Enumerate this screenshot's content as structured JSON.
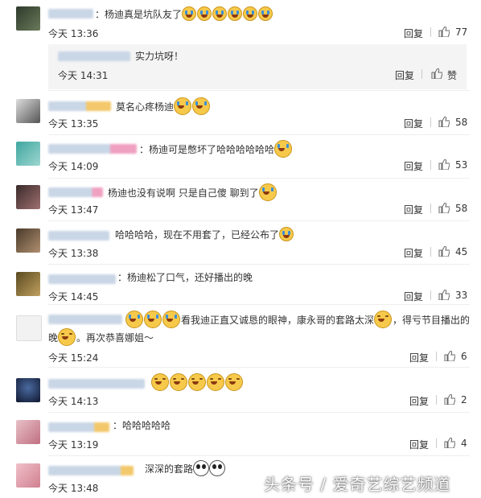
{
  "comments": [
    {
      "text": "：杨迪真是坑队友了",
      "time": "今天 13:36",
      "reply": "回复",
      "likes": "77",
      "emoji_count": 6
    },
    {
      "text": "：杨迪可是憋坏了哈哈哈哈哈哈",
      "time": "今天 14:09",
      "reply": "回复",
      "likes": "53",
      "emoji_count": 1
    },
    {
      "text": "莫名心疼杨迪",
      "time": "今天 13:35",
      "reply": "回复",
      "likes": "58",
      "emoji_count": 2
    },
    {
      "text": "杨迪也没有说啊 只是自己傻 聊到了",
      "time": "今天 13:47",
      "reply": "回复",
      "likes": "58",
      "emoji_count": 1
    },
    {
      "text": "哈哈哈哈，现在不用套了，已经公布了",
      "time": "今天 13:38",
      "reply": "回复",
      "likes": "45",
      "emoji_count": 1
    },
    {
      "text": "：杨迪松了口气，还好播出的晚",
      "time": "今天 14:45",
      "reply": "回复",
      "likes": "33",
      "emoji_count": 0
    },
    {
      "text_a": "看我迪正直又诚恳的眼神，康永哥的套路太深",
      "text_b": "，得亏节目播出的",
      "text_c": "晚",
      "text_d": "。再次恭喜娜姐～",
      "time": "今天 15:24",
      "reply": "回复",
      "likes": "6"
    },
    {
      "text": "",
      "time": "今天 14:13",
      "reply": "回复",
      "likes": "2",
      "emoji_count": 5
    },
    {
      "text": "：哈哈哈哈哈",
      "time": "今天 13:19",
      "reply": "回复",
      "likes": "4",
      "emoji_count": 0
    },
    {
      "text": "深深的套路",
      "time": "今天 13:48",
      "reply": "回复",
      "likes": "",
      "emoji_count": 2
    }
  ],
  "subreply": {
    "text": "实力坑呀！",
    "time": "今天 14:31",
    "reply": "回复",
    "like_label": "赞"
  },
  "watermark": "头条号 / 爱奇艺综艺频道"
}
